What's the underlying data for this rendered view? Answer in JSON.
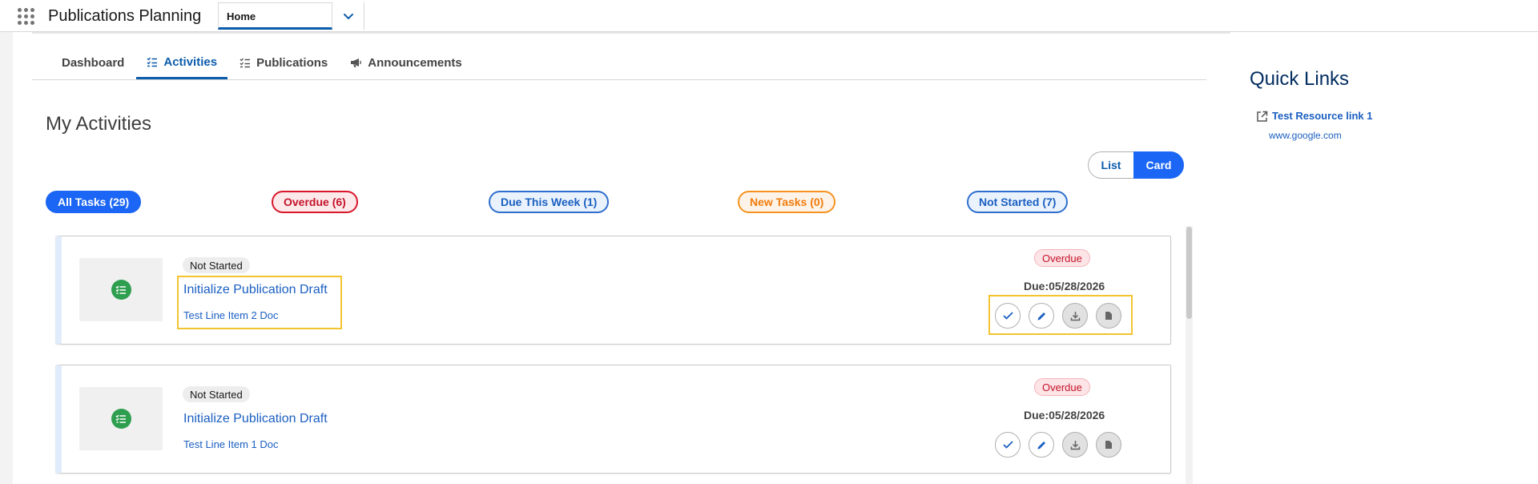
{
  "header": {
    "app_title": "Publications Planning",
    "nav_tab": "Home"
  },
  "tabs": [
    {
      "label": "Dashboard"
    },
    {
      "label": "Activities"
    },
    {
      "label": "Publications"
    },
    {
      "label": "Announcements"
    }
  ],
  "main": {
    "title": "My Activities",
    "view_toggle": {
      "list": "List",
      "card": "Card",
      "selected": "Card"
    },
    "filters": {
      "all": "All Tasks (29)",
      "overdue": "Overdue (6)",
      "week": "Due This Week (1)",
      "new": "New Tasks (0)",
      "not_started": "Not Started (7)"
    },
    "cards": [
      {
        "status": "Not Started",
        "title": "Initialize Publication Draft",
        "subtitle": "Test Line Item 2 Doc",
        "badge": "Overdue",
        "due": "Due:05/28/2026"
      },
      {
        "status": "Not Started",
        "title": "Initialize Publication Draft",
        "subtitle": "Test Line Item 1 Doc",
        "badge": "Overdue",
        "due": "Due:05/28/2026"
      }
    ]
  },
  "quick_links": {
    "title": "Quick Links",
    "items": [
      {
        "label": "Test Resource link 1",
        "url": "www.google.com"
      }
    ]
  },
  "colors": {
    "brand": "#1b66f5",
    "link": "#1b5fc1",
    "overdue": "#c4132a",
    "highlight": "#f4c430"
  },
  "icons": [
    "app-launcher-icon",
    "chevron-down-icon",
    "checklist-icon",
    "megaphone-icon",
    "check-icon",
    "edit-icon",
    "download-icon",
    "document-icon",
    "external-link-icon"
  ]
}
